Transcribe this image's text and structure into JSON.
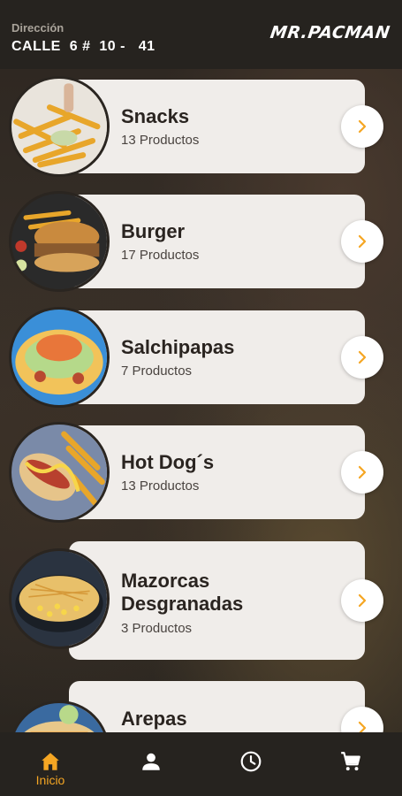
{
  "header": {
    "address_label": "Dirección",
    "address_value": "CALLE  6 #  10 -   41",
    "logo_text": "MR.PACMAN"
  },
  "categories": [
    {
      "title": "Snacks",
      "count": "13 Productos"
    },
    {
      "title": "Burger",
      "count": "17 Productos"
    },
    {
      "title": "Salchipapas",
      "count": "7 Productos"
    },
    {
      "title": "Hot Dog´s",
      "count": "13 Productos"
    },
    {
      "title_line1": "Mazorcas",
      "title_line2": "Desgranadas",
      "count": "3 Productos"
    },
    {
      "title": "Arepas"
    }
  ],
  "nav": {
    "home_label": "Inicio",
    "items": [
      "home-icon",
      "user-icon",
      "clock-icon",
      "cart-icon"
    ]
  },
  "colors": {
    "accent": "#f5a623",
    "card_bg": "#f0edea",
    "bar_bg": "#26231f"
  }
}
